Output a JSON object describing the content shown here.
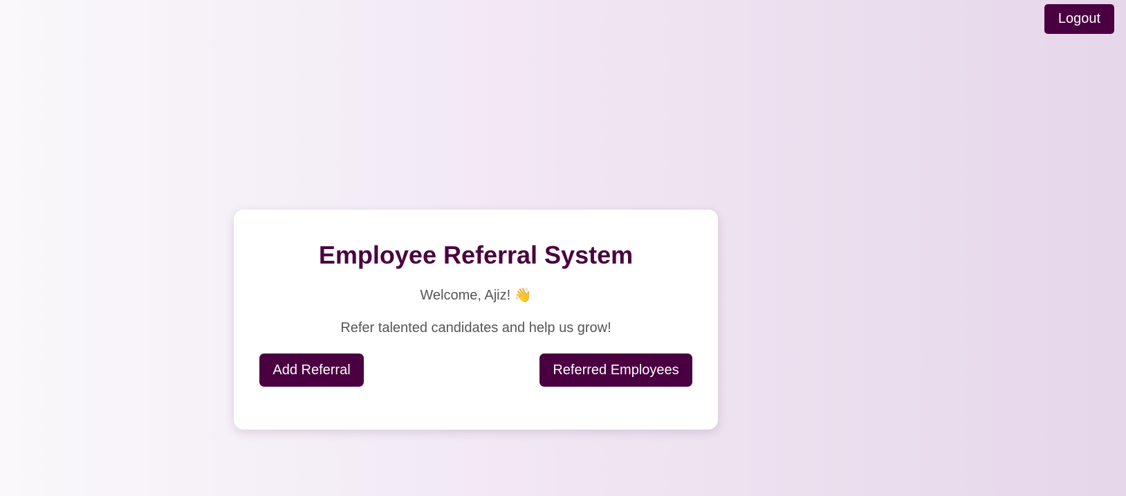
{
  "header": {
    "logout_label": "Logout"
  },
  "card": {
    "title": "Employee Referral System",
    "welcome": "Welcome, Ajiz! 👋",
    "tagline": "Refer talented candidates and help us grow!",
    "add_referral_label": "Add Referral",
    "referred_employees_label": "Referred Employees"
  },
  "colors": {
    "brand": "#4a0040",
    "text_muted": "#555555",
    "card_bg": "#ffffff"
  }
}
